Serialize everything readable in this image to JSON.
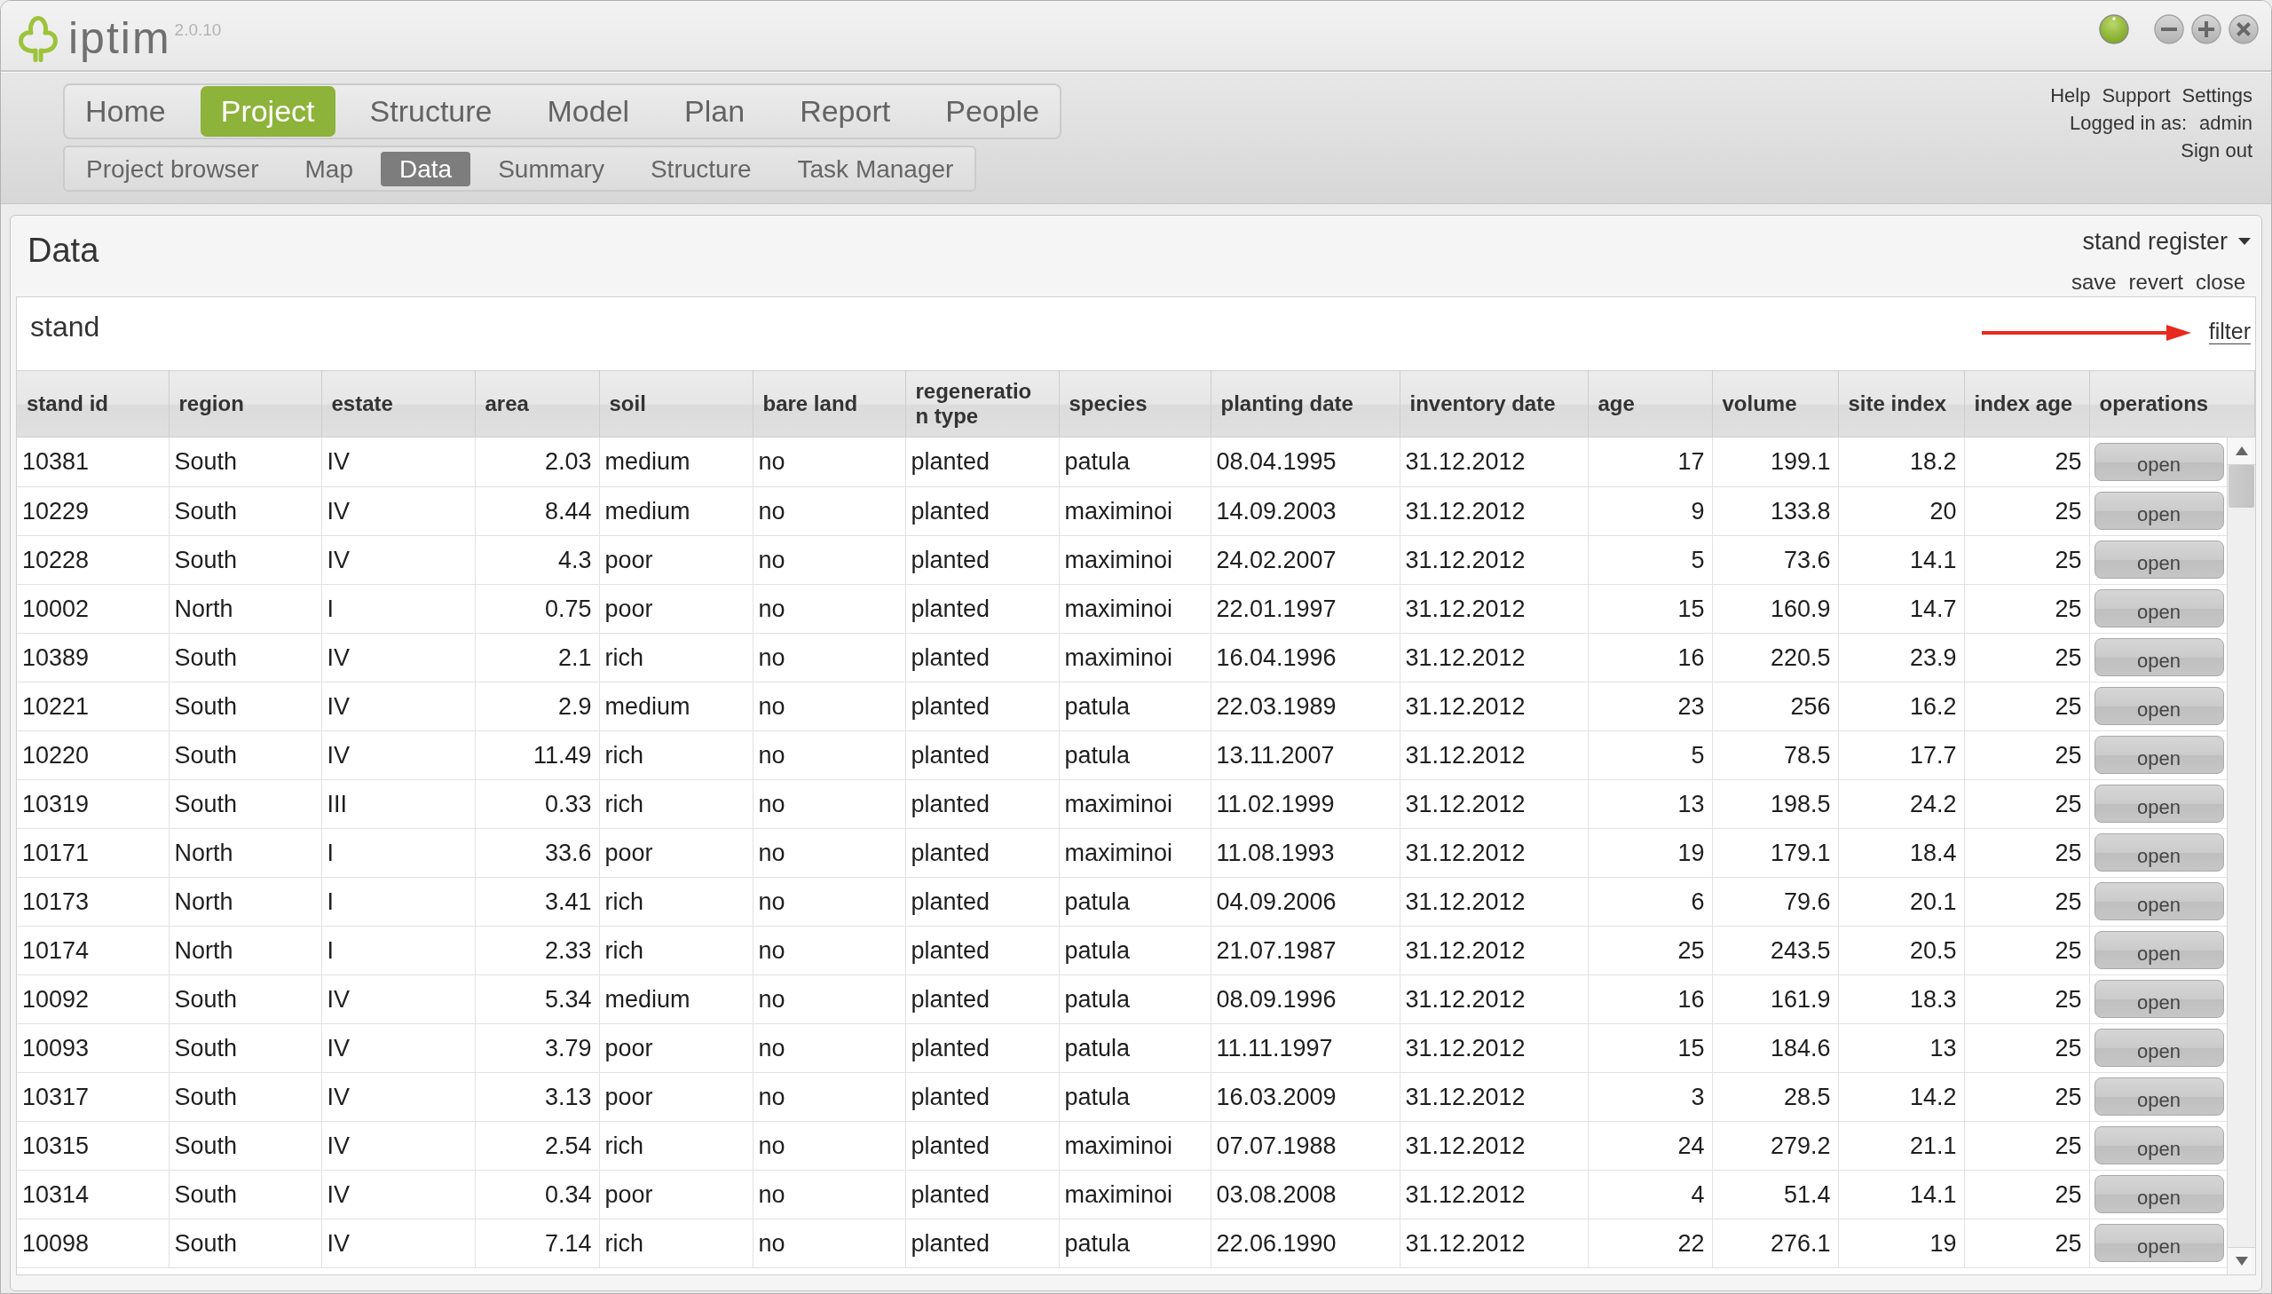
{
  "app": {
    "logo_text": "iptim",
    "version": "2.0.10"
  },
  "main_nav": [
    {
      "label": "Home",
      "selected": false
    },
    {
      "label": "Project",
      "selected": true
    },
    {
      "label": "Structure",
      "selected": false
    },
    {
      "label": "Model",
      "selected": false
    },
    {
      "label": "Plan",
      "selected": false
    },
    {
      "label": "Report",
      "selected": false
    },
    {
      "label": "People",
      "selected": false
    }
  ],
  "sub_nav": [
    {
      "label": "Project browser",
      "selected": false
    },
    {
      "label": "Map",
      "selected": false
    },
    {
      "label": "Data",
      "selected": true
    },
    {
      "label": "Summary",
      "selected": false
    },
    {
      "label": "Structure",
      "selected": false
    },
    {
      "label": "Task Manager",
      "selected": false
    }
  ],
  "user_menu": {
    "links": [
      "Help",
      "Support",
      "Settings"
    ],
    "login_label": "Logged in as:",
    "username": "admin",
    "sign_out": "Sign out"
  },
  "panel": {
    "title": "Data",
    "view_selector": "stand register",
    "actions": [
      "save",
      "revert",
      "close"
    ]
  },
  "table_panel": {
    "title": "stand",
    "filter": "filter"
  },
  "table": {
    "columns": [
      {
        "label": "stand id",
        "kind": "text"
      },
      {
        "label": "region",
        "kind": "text"
      },
      {
        "label": "estate",
        "kind": "text"
      },
      {
        "label": "area",
        "kind": "number"
      },
      {
        "label": "soil",
        "kind": "text"
      },
      {
        "label": "bare land",
        "kind": "text"
      },
      {
        "label": "regeneration type",
        "kind": "text"
      },
      {
        "label": "species",
        "kind": "text"
      },
      {
        "label": "planting date",
        "kind": "text"
      },
      {
        "label": "inventory date",
        "kind": "text"
      },
      {
        "label": "age",
        "kind": "number"
      },
      {
        "label": "volume",
        "kind": "number"
      },
      {
        "label": "site index",
        "kind": "number"
      },
      {
        "label": "index age",
        "kind": "number"
      },
      {
        "label": "operations",
        "kind": "action"
      }
    ],
    "rows": [
      [
        "10381",
        "South",
        "IV",
        "2.03",
        "medium",
        "no",
        "planted",
        "patula",
        "08.04.1995",
        "31.12.2012",
        "17",
        "199.1",
        "18.2",
        "25",
        "open"
      ],
      [
        "10229",
        "South",
        "IV",
        "8.44",
        "medium",
        "no",
        "planted",
        "maximinoi",
        "14.09.2003",
        "31.12.2012",
        "9",
        "133.8",
        "20",
        "25",
        "open"
      ],
      [
        "10228",
        "South",
        "IV",
        "4.3",
        "poor",
        "no",
        "planted",
        "maximinoi",
        "24.02.2007",
        "31.12.2012",
        "5",
        "73.6",
        "14.1",
        "25",
        "open"
      ],
      [
        "10002",
        "North",
        "I",
        "0.75",
        "poor",
        "no",
        "planted",
        "maximinoi",
        "22.01.1997",
        "31.12.2012",
        "15",
        "160.9",
        "14.7",
        "25",
        "open"
      ],
      [
        "10389",
        "South",
        "IV",
        "2.1",
        "rich",
        "no",
        "planted",
        "maximinoi",
        "16.04.1996",
        "31.12.2012",
        "16",
        "220.5",
        "23.9",
        "25",
        "open"
      ],
      [
        "10221",
        "South",
        "IV",
        "2.9",
        "medium",
        "no",
        "planted",
        "patula",
        "22.03.1989",
        "31.12.2012",
        "23",
        "256",
        "16.2",
        "25",
        "open"
      ],
      [
        "10220",
        "South",
        "IV",
        "11.49",
        "rich",
        "no",
        "planted",
        "patula",
        "13.11.2007",
        "31.12.2012",
        "5",
        "78.5",
        "17.7",
        "25",
        "open"
      ],
      [
        "10319",
        "South",
        "III",
        "0.33",
        "rich",
        "no",
        "planted",
        "maximinoi",
        "11.02.1999",
        "31.12.2012",
        "13",
        "198.5",
        "24.2",
        "25",
        "open"
      ],
      [
        "10171",
        "North",
        "I",
        "33.6",
        "poor",
        "no",
        "planted",
        "maximinoi",
        "11.08.1993",
        "31.12.2012",
        "19",
        "179.1",
        "18.4",
        "25",
        "open"
      ],
      [
        "10173",
        "North",
        "I",
        "3.41",
        "rich",
        "no",
        "planted",
        "patula",
        "04.09.2006",
        "31.12.2012",
        "6",
        "79.6",
        "20.1",
        "25",
        "open"
      ],
      [
        "10174",
        "North",
        "I",
        "2.33",
        "rich",
        "no",
        "planted",
        "patula",
        "21.07.1987",
        "31.12.2012",
        "25",
        "243.5",
        "20.5",
        "25",
        "open"
      ],
      [
        "10092",
        "South",
        "IV",
        "5.34",
        "medium",
        "no",
        "planted",
        "patula",
        "08.09.1996",
        "31.12.2012",
        "16",
        "161.9",
        "18.3",
        "25",
        "open"
      ],
      [
        "10093",
        "South",
        "IV",
        "3.79",
        "poor",
        "no",
        "planted",
        "patula",
        "11.11.1997",
        "31.12.2012",
        "15",
        "184.6",
        "13",
        "25",
        "open"
      ],
      [
        "10317",
        "South",
        "IV",
        "3.13",
        "poor",
        "no",
        "planted",
        "patula",
        "16.03.2009",
        "31.12.2012",
        "3",
        "28.5",
        "14.2",
        "25",
        "open"
      ],
      [
        "10315",
        "South",
        "IV",
        "2.54",
        "rich",
        "no",
        "planted",
        "maximinoi",
        "07.07.1988",
        "31.12.2012",
        "24",
        "279.2",
        "21.1",
        "25",
        "open"
      ],
      [
        "10314",
        "South",
        "IV",
        "0.34",
        "poor",
        "no",
        "planted",
        "maximinoi",
        "03.08.2008",
        "31.12.2012",
        "4",
        "51.4",
        "14.1",
        "25",
        "open"
      ],
      [
        "10098",
        "South",
        "IV",
        "7.14",
        "rich",
        "no",
        "planted",
        "patula",
        "22.06.1990",
        "31.12.2012",
        "22",
        "276.1",
        "19",
        "25",
        "open"
      ]
    ]
  }
}
